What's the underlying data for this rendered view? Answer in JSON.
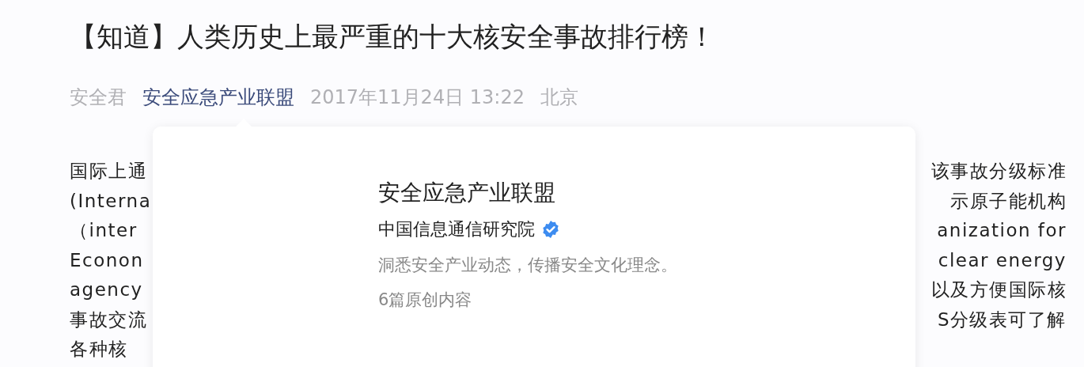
{
  "article": {
    "title": "【知道】人类历史上最严重的十大核安全事故排行榜！",
    "meta": {
      "author": "安全君",
      "account": "安全应急产业联盟",
      "date": "2017年11月24日 13:22",
      "location": "北京"
    },
    "body_lines": [
      {
        "left": "国际上通",
        "right": "该事故分级标准"
      },
      {
        "left": "(Interna",
        "right": "示原子能机构"
      },
      {
        "left": "（inter",
        "right": "anization for"
      },
      {
        "left": "Econon",
        "right": "clear energy"
      },
      {
        "left": "agency",
        "right": "以及方便国际核"
      },
      {
        "left": "事故交流",
        "right": "S分级表可了解"
      },
      {
        "left": "各种核"
      }
    ]
  },
  "profile_card": {
    "name": "安全应急产业联盟",
    "organization": "中国信息通信研究院",
    "verified": true,
    "description": "洞悉安全产业动态，传播安全文化理念。",
    "original_count": "6篇原创内容"
  }
}
